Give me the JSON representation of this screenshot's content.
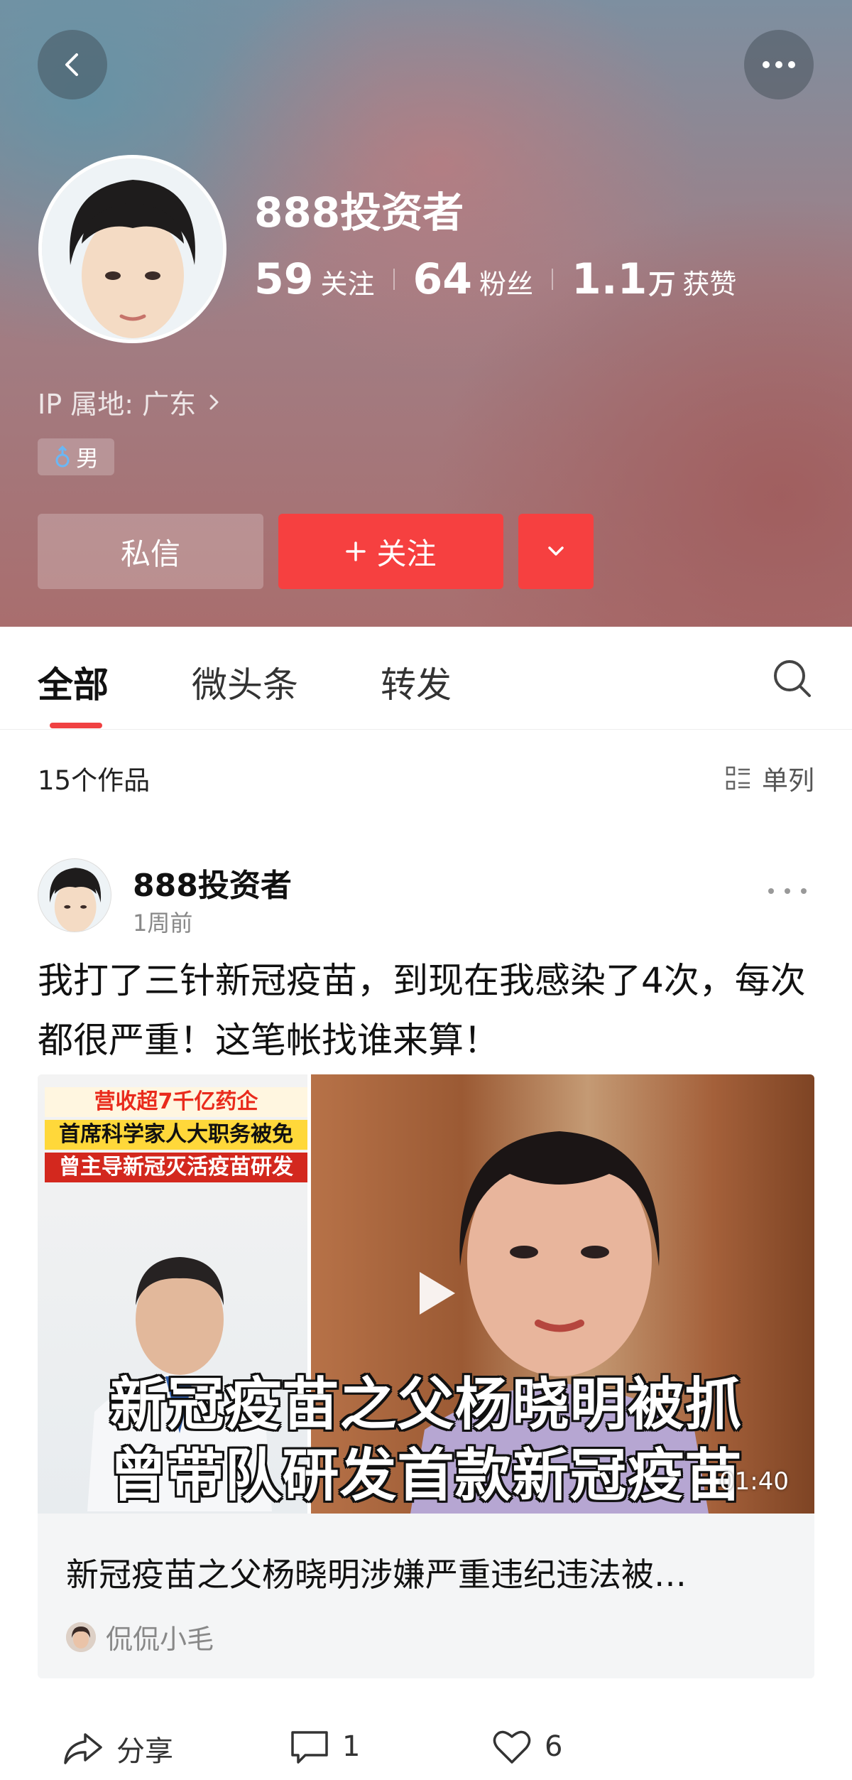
{
  "profile": {
    "name": "888投资者",
    "stats": [
      {
        "value": "59",
        "label": "关注"
      },
      {
        "value": "64",
        "label": "粉丝"
      },
      {
        "value": "1.1",
        "unit": "万",
        "label": "获赞"
      }
    ],
    "ip_location": "IP 属地: 广东",
    "gender": "男",
    "dm_label": "私信",
    "follow_label": "关注"
  },
  "tabs": [
    {
      "label": "全部",
      "active": true
    },
    {
      "label": "微头条",
      "active": false
    },
    {
      "label": "转发",
      "active": false
    }
  ],
  "works": {
    "count_text": "15个作品",
    "view_mode": "单列"
  },
  "post": {
    "author": "888投资者",
    "time": "1周前",
    "text": "我打了三针新冠疫苗，到现在我感染了4次，每次都很严重！这笔帐找谁来算！",
    "video": {
      "thumb_headlines": [
        "营收超7千亿药企",
        "首席科学家人大职务被免",
        "曾主导新冠灭活疫苗研发"
      ],
      "thumb_captions": [
        "新冠疫苗之父杨晓明被抓",
        "曾带队研发首款新冠疫苗"
      ],
      "duration": "01:40",
      "title": "新冠疫苗之父杨晓明涉嫌严重违纪违法被…",
      "source_name": "侃侃小毛"
    },
    "actions": {
      "share_label": "分享",
      "comment_count": "1",
      "like_count": "6"
    }
  },
  "colors": {
    "accent": "#f64040",
    "tab_indicator": "#f04142"
  }
}
